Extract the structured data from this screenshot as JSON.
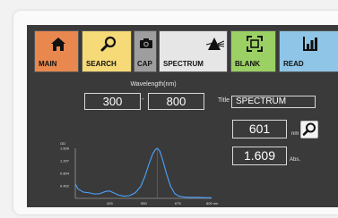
{
  "toolbar": {
    "main": "MAIN",
    "search": "SEARCH",
    "cap": "CAP",
    "spectrum": "SPECTRUM",
    "blank": "BLANK",
    "read": "READ"
  },
  "wavelength": {
    "title": "Wavelength(nm)",
    "from": "300",
    "separator": "-",
    "to": "800"
  },
  "title_field": {
    "label": "Title",
    "value": "SPECTRUM"
  },
  "readout": {
    "nm_value": "601",
    "nm_unit": "nm",
    "abs_value": "1.609",
    "abs_unit": "Abs."
  },
  "colors": {
    "main": "#e8884f",
    "search": "#f6da78",
    "cap": "#9e9e9e",
    "spectrum": "#e6e6e6",
    "blank": "#9bd064",
    "read": "#8fc5e6",
    "screen": "#3a3a3a",
    "curve": "#4da3ff"
  },
  "chart_data": {
    "type": "line",
    "ylabel": "OD",
    "xlabel": "",
    "y_ticks": [
      "1.609",
      "1.207",
      "0.804",
      "0.402"
    ],
    "x_ticks": [
      "425",
      "550",
      "675",
      "800 nm"
    ],
    "xlim": [
      300,
      800
    ],
    "ylim": [
      0,
      1.609
    ],
    "series": [
      {
        "x": [
          300,
          310,
          330,
          350,
          370,
          390,
          410,
          425,
          440,
          460,
          480,
          500,
          520,
          540,
          555,
          570,
          585,
          595,
          601,
          610,
          620,
          635,
          650,
          665,
          680,
          700,
          720,
          750,
          780,
          800
        ],
        "values": [
          0.46,
          0.3,
          0.2,
          0.18,
          0.14,
          0.15,
          0.22,
          0.24,
          0.18,
          0.1,
          0.07,
          0.09,
          0.18,
          0.38,
          0.7,
          1.1,
          1.45,
          1.58,
          1.609,
          1.52,
          1.25,
          0.78,
          0.38,
          0.15,
          0.07,
          0.04,
          0.03,
          0.03,
          0.02,
          0.02
        ]
      }
    ]
  }
}
